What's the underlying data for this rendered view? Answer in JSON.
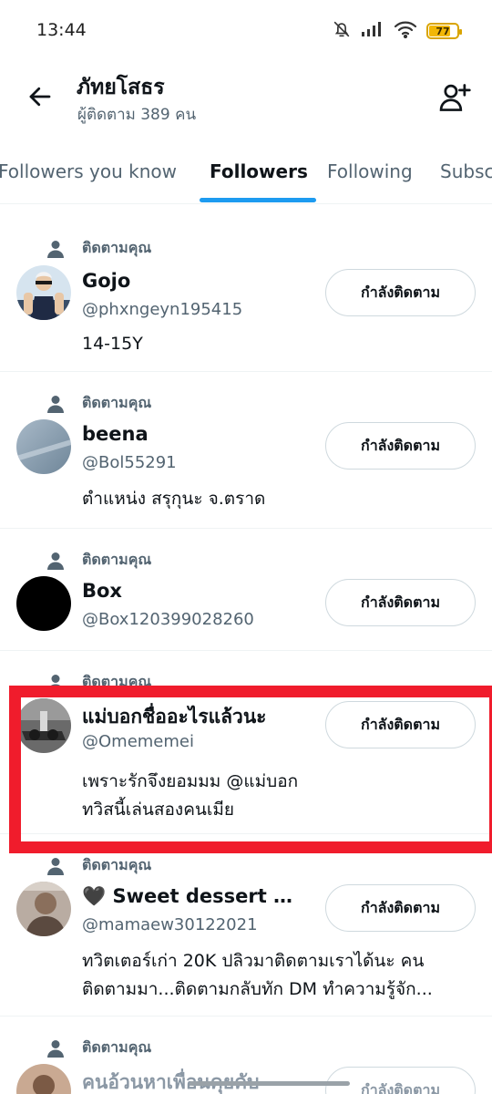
{
  "status_bar": {
    "time": "13:44",
    "battery_level": "77",
    "battery_fraction": 0.77
  },
  "header": {
    "title": "ภัทยโสธร",
    "subtitle": "ผู้ติดตาม 389 คน"
  },
  "tabs": [
    {
      "label": "Followers you know",
      "active": false
    },
    {
      "label": "Followers",
      "active": true
    },
    {
      "label": "Following",
      "active": false
    },
    {
      "label": "Subscriptions",
      "active": false
    }
  ],
  "followers": [
    {
      "follows_you": "ติดตามคุณ",
      "name": "Gojo",
      "handle": "@phxngeyn195415",
      "bio": "14-15Y",
      "button": "กำลังติดตาม"
    },
    {
      "follows_you": "ติดตามคุณ",
      "name": "beena",
      "handle": "@Bol55291",
      "bio": "ตำแหน่ง สรุกุนะ จ.ตราด",
      "button": "กำลังติดตาม"
    },
    {
      "follows_you": "ติดตามคุณ",
      "name": "Box",
      "handle": "@Box120399028260",
      "bio": "",
      "button": "กำลังติดตาม"
    },
    {
      "follows_you": "ติดตามคุณ",
      "name": "แม่บอกชื่ออะไรแล้วนะ",
      "handle": "@Omememei",
      "bio": "เพราะรักจึงยอมมม @แม่บอก\nทวิสนี้เล่นสองคนเมีย",
      "button": "กำลังติดตาม"
    },
    {
      "follows_you": "ติดตามคุณ",
      "name": "🖤 Sweet dessert 🌹 (s...",
      "handle": "@mamaew30122021",
      "bio": "ทวิตเตอร์เก่า 20K ปลิวมาติดตามเราได้นะ คน ติดตามมา...ติดตามกลับทัก DM ทำความรู้จัก...",
      "button": "กำลังติดตาม"
    },
    {
      "follows_you": "ติดตามคุณ",
      "name": "คนอ้วนหาเพื่อนคุยคับ",
      "handle": "",
      "bio": "",
      "button": "กำลังติดตาม"
    }
  ],
  "colors": {
    "accent": "#1d9bf0",
    "highlight": "#f01c2c",
    "secondary_text": "#536471"
  },
  "icons": [
    "mute-icon",
    "signal-icon",
    "wifi-icon",
    "battery-icon",
    "back-arrow-icon",
    "add-user-icon",
    "person-icon"
  ]
}
